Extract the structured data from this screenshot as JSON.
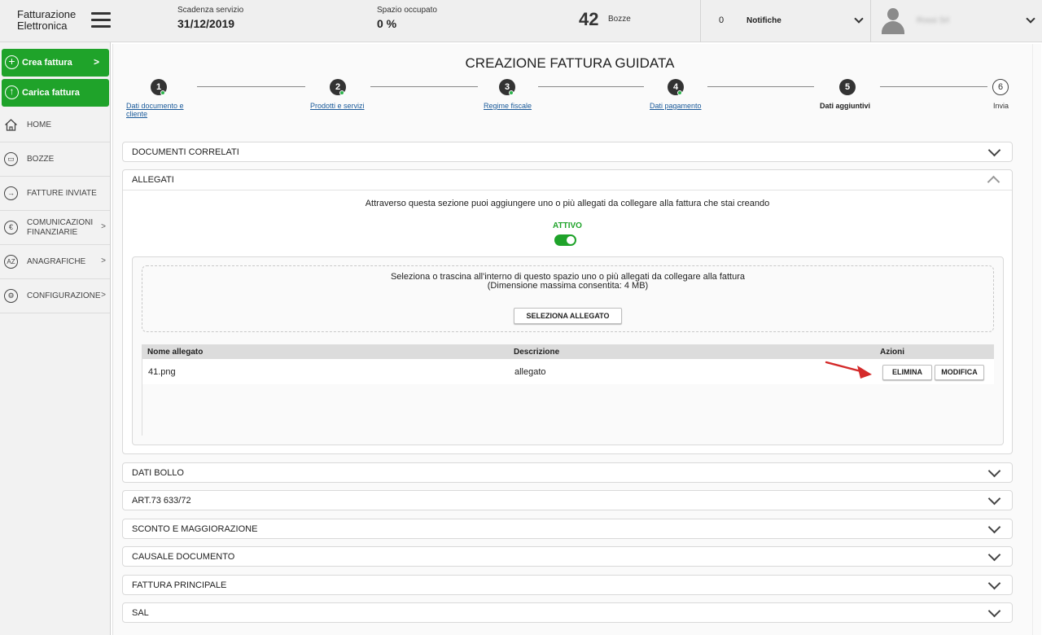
{
  "header": {
    "logo_line1": "Fatturazione",
    "logo_line2": "Elettronica",
    "scadenza_label": "Scadenza servizio",
    "scadenza_value": "31/12/2019",
    "spazio_label": "Spazio occupato",
    "spazio_value": "0 %",
    "bozze_count": "42",
    "bozze_label": "Bozze",
    "notifiche_count": "0",
    "notifiche_label": "Notifiche",
    "user_name": "Rossi Srl"
  },
  "sidebar": {
    "crea_fattura": "Crea fattura",
    "carica_fattura": "Carica fattura",
    "items": [
      {
        "label": "HOME",
        "icon": "home-icon"
      },
      {
        "label": "BOZZE",
        "icon": "drafts-icon"
      },
      {
        "label": "FATTURE INVIATE",
        "icon": "arrow-right-circle-icon"
      },
      {
        "label_line1": "COMUNICAZIONI",
        "label_line2": "FINANZIARIE",
        "icon": "coin-icon"
      },
      {
        "label": "ANAGRAFICHE",
        "icon": "az-icon"
      },
      {
        "label": "CONFIGURAZIONE",
        "icon": "gear-icon"
      }
    ]
  },
  "main": {
    "title": "CREAZIONE FATTURA GUIDATA",
    "steps": [
      {
        "num": "1",
        "label_line1": "Dati documento e",
        "label_line2": "cliente"
      },
      {
        "num": "2",
        "label": "Prodotti e servizi"
      },
      {
        "num": "3",
        "label": "Regime fiscale"
      },
      {
        "num": "4",
        "label": "Dati pagamento"
      },
      {
        "num": "5",
        "label": "Dati aggiuntivi"
      },
      {
        "num": "6",
        "label": "Invia"
      }
    ],
    "panels": {
      "documenti_correlati": "DOCUMENTI CORRELATI",
      "allegati": "ALLEGATI",
      "dati_bollo": "DATI BOLLO",
      "art73": "ART.73 633/72",
      "sconto": "SCONTO E MAGGIORAZIONE",
      "causale": "CAUSALE DOCUMENTO",
      "fattura_principale": "FATTURA PRINCIPALE",
      "sal": "SAL"
    },
    "allegati": {
      "description": "Attraverso questa sezione puoi aggiungere uno o più allegati da collegare alla fattura che stai creando",
      "status": "ATTIVO",
      "toggle_on": true,
      "drop_line1": "Seleziona o trascina all'interno di questo spazio uno o più allegati da collegare alla fattura",
      "drop_line2": "(Dimensione massima consentita: 4 MB)",
      "select_button": "SELEZIONA ALLEGATO",
      "table": {
        "headers": [
          "Nome allegato",
          "Descrizione",
          "Azioni"
        ],
        "rows": [
          {
            "name": "41.png",
            "description": "allegato"
          }
        ],
        "delete_button": "ELIMINA",
        "edit_button": "MODIFICA"
      }
    }
  },
  "colors": {
    "accent_green": "#1fa32a",
    "annotation_arrow": "#d42a2a",
    "link_blue": "#1a5a9a"
  }
}
